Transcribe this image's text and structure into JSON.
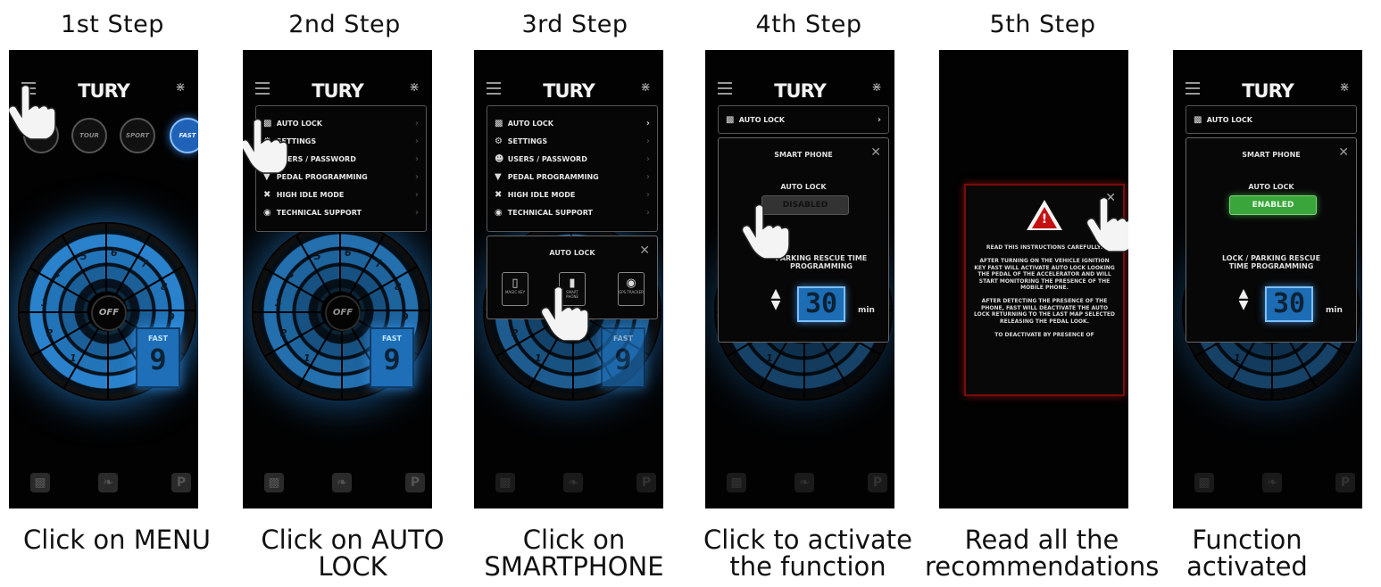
{
  "steps": [
    {
      "title": "1st Step",
      "caption": "Click on MENU"
    },
    {
      "title": "2nd Step",
      "caption": "Click on AUTO LOCK"
    },
    {
      "title": "3rd Step",
      "caption": "Click on SMARTPHONE"
    },
    {
      "title": "4th Step",
      "caption": "Click to activate the function"
    },
    {
      "title": "5th Step",
      "caption": "Read all the recommendations"
    },
    {
      "title": "",
      "caption": "Function activated"
    }
  ],
  "app": {
    "logo": "TURY",
    "bluetooth_icon": "bluetooth-icon",
    "menu_icon": "hamburger-menu-icon",
    "modes": [
      "TOUR",
      "SPORT",
      "FAST"
    ],
    "gauge": {
      "center_label": "OFF",
      "numbers": [
        "1",
        "2",
        "3",
        "4",
        "5",
        "6",
        "7",
        "8",
        "9"
      ]
    },
    "current_map": {
      "label": "FAST",
      "value": "9"
    },
    "bottom_icons": [
      "lock-icon",
      "leaf-icon",
      "parking-icon"
    ],
    "bottom_parking_label": "P"
  },
  "menu": {
    "items": [
      {
        "label": "AUTO LOCK",
        "icon": "lock-icon"
      },
      {
        "label": "SETTINGS",
        "icon": "gear-icon"
      },
      {
        "label": "USERS / PASSWORD",
        "icon": "user-icon"
      },
      {
        "label": "PEDAL PROGRAMMING",
        "icon": "pedal-icon"
      },
      {
        "label": "HIGH IDLE MODE",
        "icon": "wrench-icon"
      },
      {
        "label": "TECHNICAL SUPPORT",
        "icon": "headset-icon"
      }
    ]
  },
  "autolock_panel": {
    "title": "AUTO LOCK",
    "options": [
      {
        "label": "MAGIC KEY",
        "icon": "key-fob-icon"
      },
      {
        "label": "SMART PHONE",
        "icon": "smartphone-icon"
      },
      {
        "label": "GPS TRACKER",
        "icon": "location-pin-icon"
      }
    ]
  },
  "smartphone_panel": {
    "title": "SMART PHONE",
    "auto_lock_label": "AUTO LOCK",
    "state_disabled": "DISABLED",
    "state_enabled": "ENABLED",
    "parking_label_step4": "PARKING RESCUE TIME PROGRAMMING",
    "parking_label_step6": "LOCK / PARKING RESCUE TIME PROGRAMMING",
    "time_value": "30",
    "time_unit": "min"
  },
  "warning": {
    "text": "READ THIS INSTRUCTIONS CAREFULLY:\n\nAFTER TURNING ON THE VEHICLE IGNITION KEY FAST WILL ACTIVATE AUTO LOCK LOOKING THE PEDAL OF THE ACCELERATOR AND WILL START MONITORING THE PRESENCE OF THE MOBILE PHONE.\n\nAFTER DETECTING THE PRESENCE OF THE PHONE, FAST WILL DEACTIVATE THE AUTO LOCK RETURNING TO THE LAST MAP SELECTED RELEASING THE PEDAL LOOK.\n\nTO DEACTIVATE BY PRESENCE OF"
  },
  "colors": {
    "accent_blue": "#2a82cc",
    "enabled_green": "#3aa53a",
    "warning_red": "#c41010"
  }
}
